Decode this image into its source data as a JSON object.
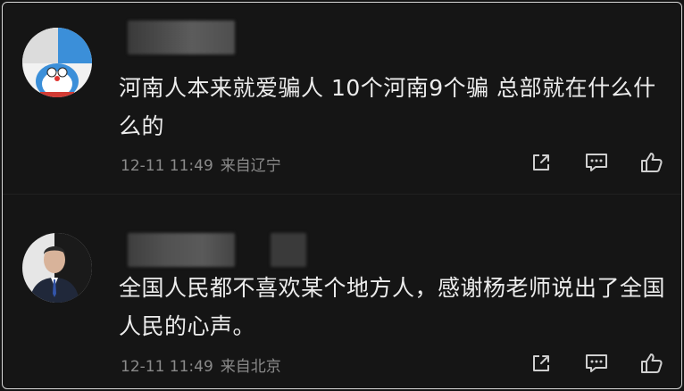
{
  "comments": [
    {
      "text": "河南人本来就爱骗人 10个河南9个骗 总部就在什么什么的",
      "time": "12-11 11:49",
      "location": "来自辽宁"
    },
    {
      "text": "全国人民都不喜欢某个地方人，感谢杨老师说出了全国人民的心声。",
      "time": "12-11 11:49",
      "location": "来自北京"
    }
  ],
  "icons": {
    "share": "share-icon",
    "reply": "comment-icon",
    "like": "thumbs-up-icon"
  }
}
